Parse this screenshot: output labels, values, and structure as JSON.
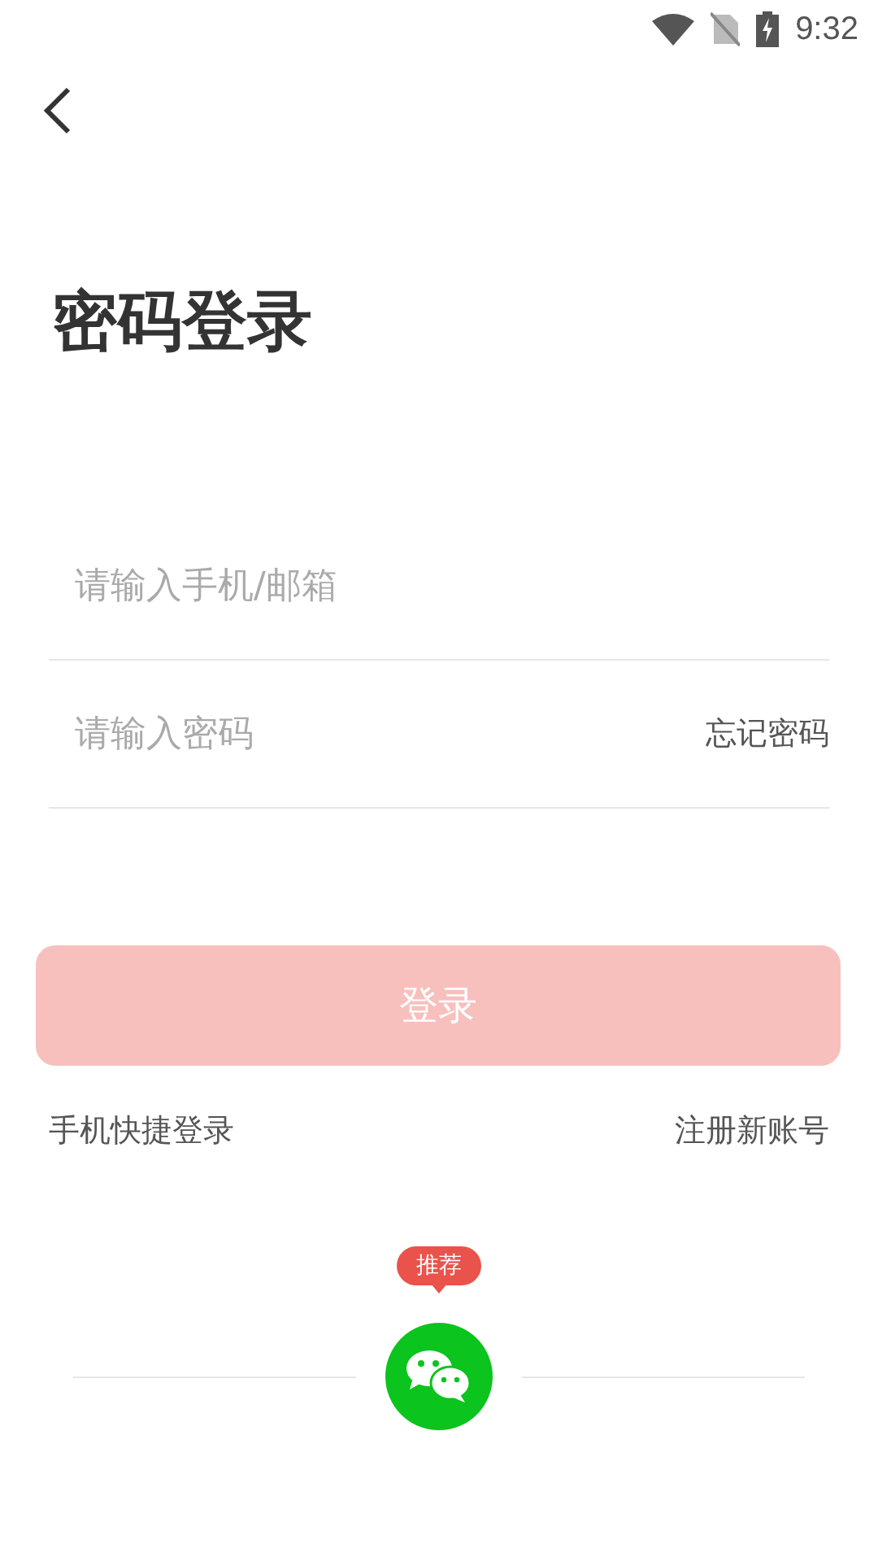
{
  "status_bar": {
    "time": "9:32"
  },
  "title": "密码登录",
  "fields": [
    {
      "placeholder": "请输入手机/邮箱"
    },
    {
      "placeholder": "请输入密码",
      "action": "忘记密码"
    }
  ],
  "login_button": {
    "label": "登录",
    "disabled": true
  },
  "links": [
    "手机快捷登录",
    "注册新账号"
  ],
  "social": {
    "badge": "推荐"
  }
}
